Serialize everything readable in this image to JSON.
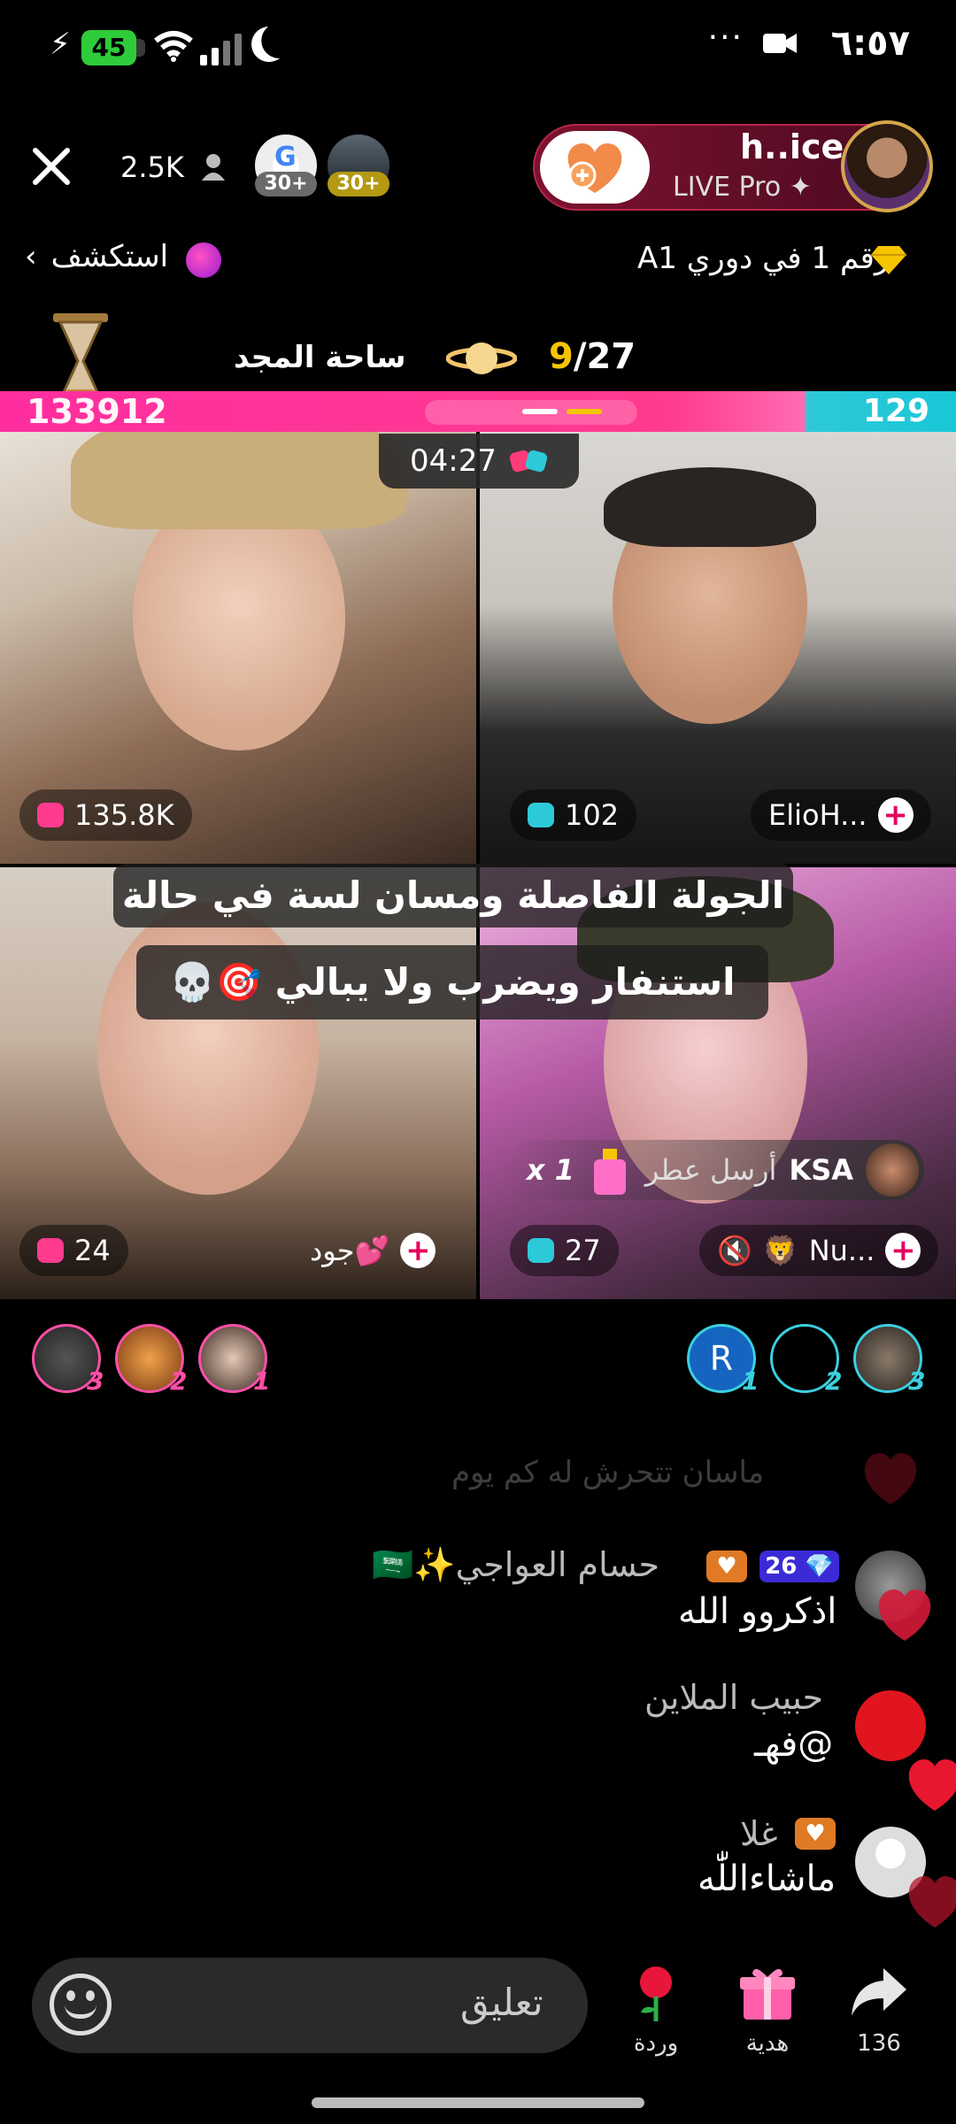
{
  "status_bar": {
    "time": "٦:٥٧",
    "battery": "45",
    "dots": "···"
  },
  "header": {
    "viewer_count": "2.5K",
    "rank_badges": [
      "30+",
      "30+"
    ],
    "host_name": "h..ice",
    "host_subtitle": "LIVE Pro ✦",
    "league_text": "رقم 1 في دوري A1",
    "explore_label": "استكشف"
  },
  "glory": {
    "title": "ساحة المجد",
    "score_current": "9",
    "score_total": "/27"
  },
  "pk": {
    "left_score": "133912",
    "right_score": "129",
    "timer": "04:27"
  },
  "tiles": [
    {
      "score": "135.8K"
    },
    {
      "score": "102",
      "name": "ElioH..."
    },
    {
      "score": "24",
      "name": "جود💕"
    },
    {
      "score": "27",
      "name": "Nu..."
    }
  ],
  "caption": {
    "line1": "الجولة الفاصلة ومسان لسة في حالة",
    "line2": "استنفار ويضرب ولا يبالي 🎯💀"
  },
  "gift_notice": {
    "sender": "KSA",
    "text": "أرسل عطر",
    "count": "x 1"
  },
  "contributors": {
    "left": [
      {
        "rank": "3"
      },
      {
        "rank": "2"
      },
      {
        "rank": "1"
      }
    ],
    "right": [
      {
        "initial": "R",
        "rank": "1"
      },
      {
        "rank": "2"
      },
      {
        "rank": "3"
      }
    ]
  },
  "chat": {
    "faded": "ماسان تتحرش له كم يوم",
    "messages": [
      {
        "name": "حسام العواجي✨🇸🇦",
        "level": "26",
        "text": "اذكروو الله"
      },
      {
        "name": "حبيب الملاين",
        "text": "@فهـ"
      },
      {
        "name": "غلا",
        "text": "ماشاءاللّٰه"
      }
    ]
  },
  "bottom_bar": {
    "comment_placeholder": "تعليق",
    "rose_label": "وردة",
    "gift_label": "هدية",
    "share_count": "136"
  },
  "colors": {
    "pk_pink": "#ff2ea0",
    "pk_cyan": "#19c7d8",
    "accent_gold": "#f6c500"
  }
}
